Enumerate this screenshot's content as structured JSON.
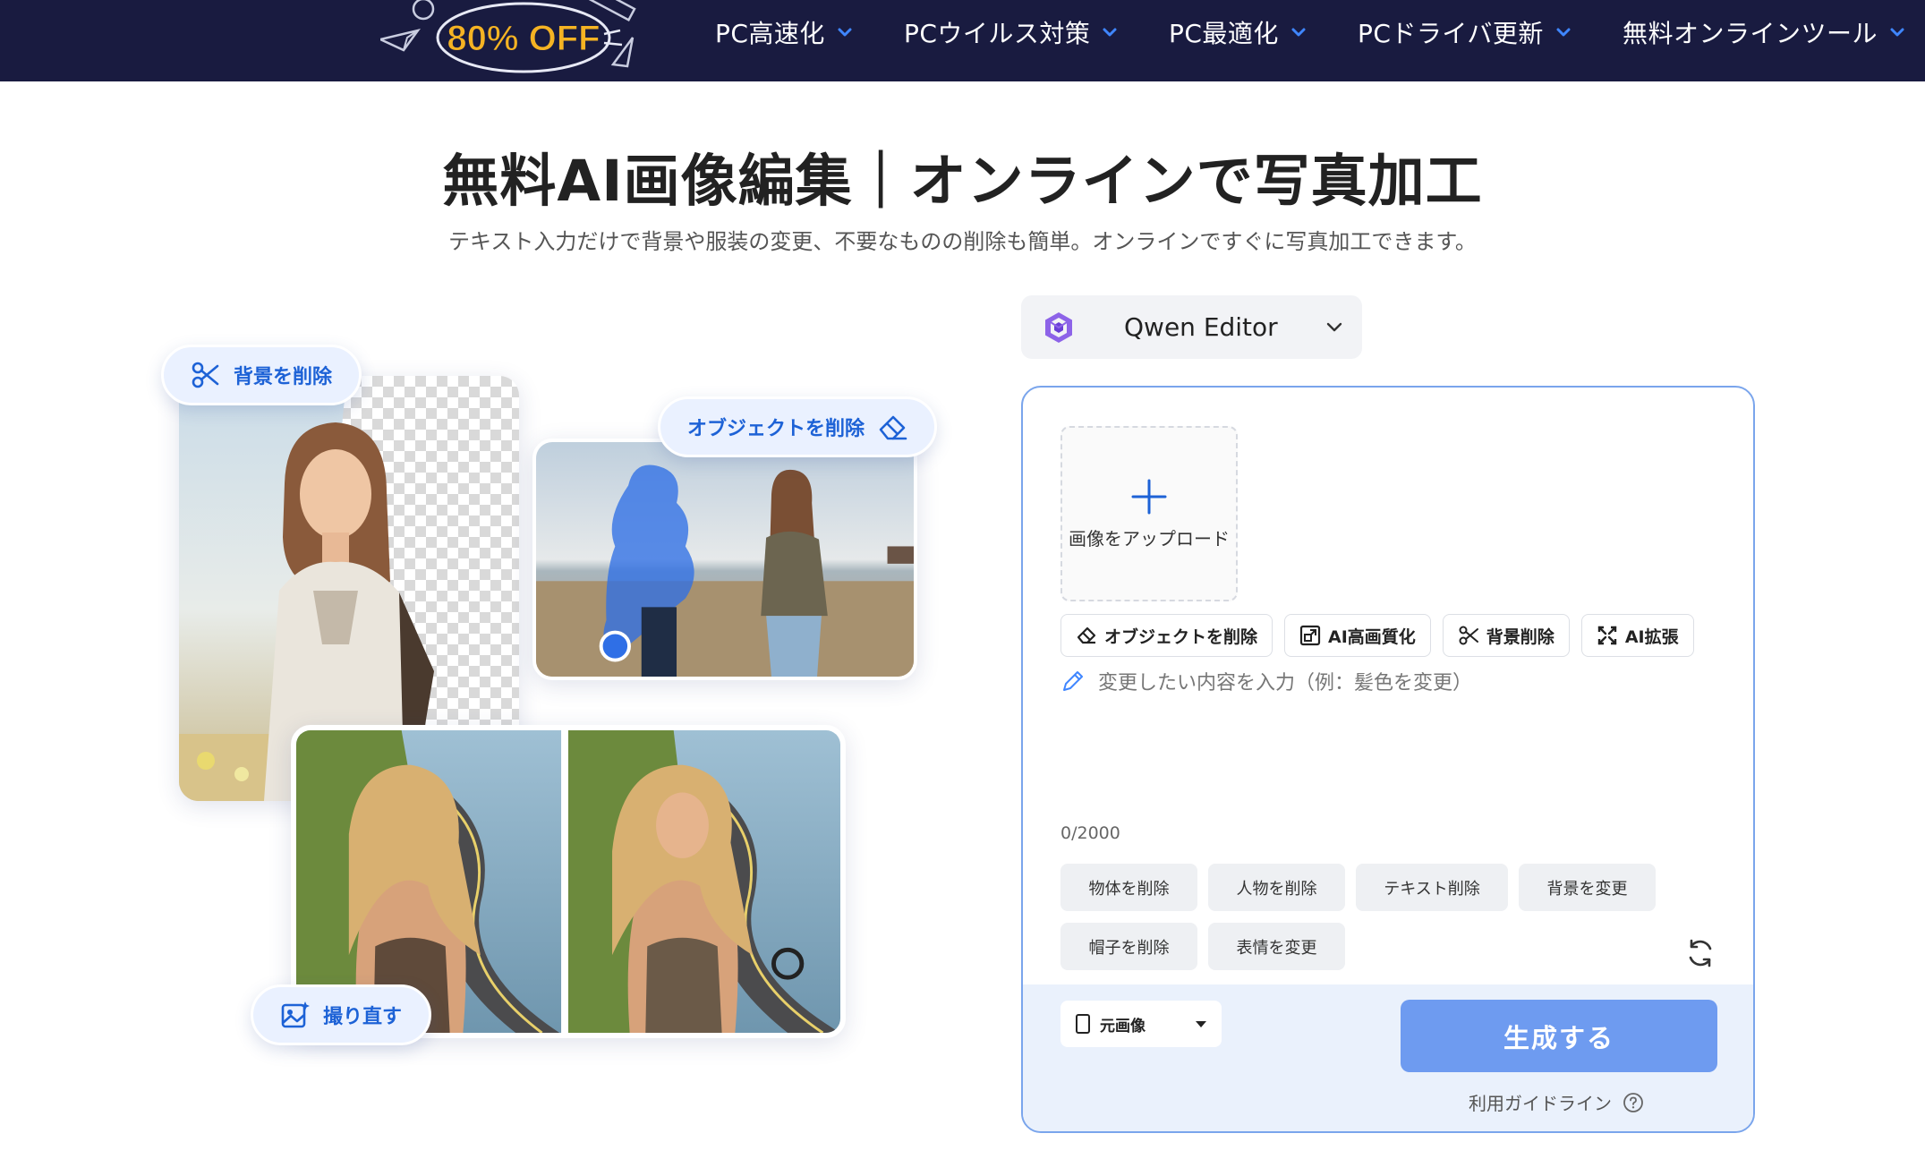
{
  "nav": {
    "promo_text": "80% OFF",
    "items": [
      {
        "label": "PC高速化"
      },
      {
        "label": "PCウイルス対策"
      },
      {
        "label": "PC最適化"
      },
      {
        "label": "PCドライバ更新"
      },
      {
        "label": "無料オンラインツール"
      }
    ]
  },
  "hero": {
    "title": "無料AI画像編集｜オンラインで写真加工",
    "subtitle": "テキスト入力だけで背景や服装の変更、不要なものの削除も簡単。オンラインですぐに写真加工できます。"
  },
  "showcase": {
    "remove_bg_label": "背景を削除",
    "remove_object_label": "オブジェクトを削除",
    "retake_label": "撮り直す"
  },
  "editor": {
    "model_name": "Qwen Editor",
    "upload_label": "画像をアップロード",
    "tools": [
      {
        "label": "オブジェクトを削除",
        "icon": "eraser-icon"
      },
      {
        "label": "AI高画質化",
        "icon": "upscale-icon"
      },
      {
        "label": "背景削除",
        "icon": "scissors-icon"
      },
      {
        "label": "AI拡張",
        "icon": "expand-icon"
      }
    ],
    "prompt_placeholder": "変更したい内容を入力（例：髪色を変更）",
    "char_counter": "0/2000",
    "chips": [
      {
        "label": "物体を削除"
      },
      {
        "label": "人物を削除"
      },
      {
        "label": "テキスト削除"
      },
      {
        "label": "背景を変更"
      },
      {
        "label": "帽子を削除"
      },
      {
        "label": "表情を変更"
      }
    ],
    "aspect_ratio": "元画像",
    "generate_label": "生成する",
    "guideline_label": "利用ガイドライン"
  },
  "colors": {
    "nav_bg": "#191b40",
    "accent_blue": "#1d62d6",
    "generate_button": "#6e9bf0",
    "panel_border": "#7aa5ec",
    "promo_yellow": "#f5b323"
  }
}
